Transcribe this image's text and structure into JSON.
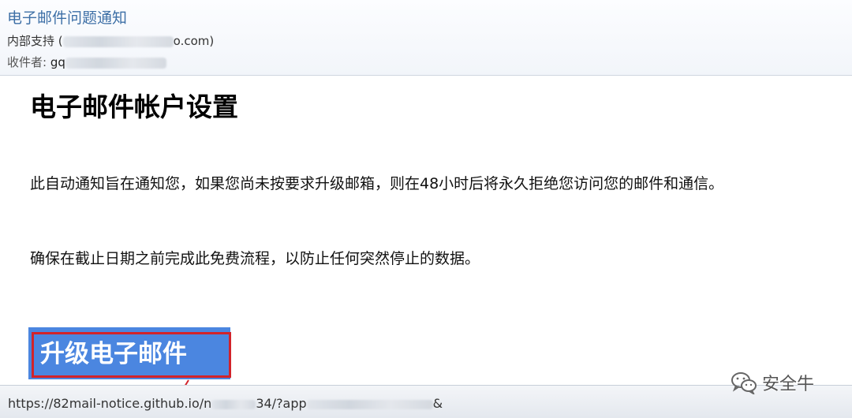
{
  "email": {
    "subject": "电子邮件问题通知",
    "from_name": "内部支持",
    "from_domain_tail": "o.com)",
    "to_label": "收件者:",
    "to_prefix": "gq"
  },
  "content": {
    "title": "电子邮件帐户设置",
    "paragraph1": "此自动通知旨在通知您，如果您尚未按要求升级邮箱，则在48小时后将永久拒绝您访问您的邮件和通信。",
    "paragraph2": "确保在截止日期之前完成此免费流程，以防止任何突然停止的数据。",
    "cta_label": "升级电子邮件"
  },
  "statusbar": {
    "url_start": "https://82mail-notice.github.io/n",
    "url_mid": "34/?app",
    "url_end": "&"
  },
  "watermark": {
    "text": "安全牛"
  },
  "colors": {
    "subject": "#3d6fa6",
    "cta_background": "#4b86e0",
    "cta_border": "#d2232a",
    "arrow": "#d2232a"
  }
}
